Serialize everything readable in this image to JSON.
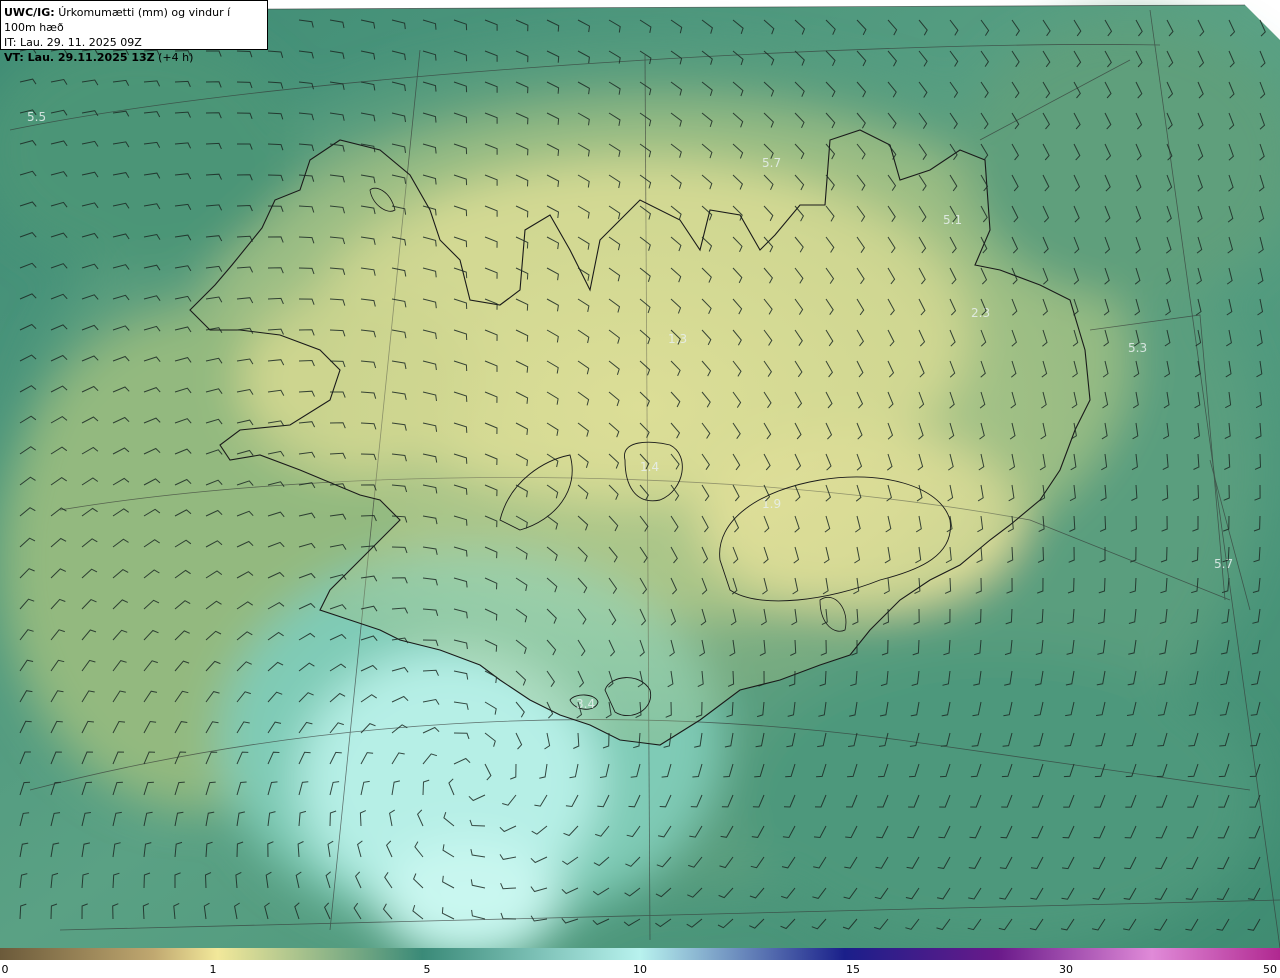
{
  "header": {
    "model": "UWC/IG:",
    "title": "Úrkomumætti (mm) og vindur í 100m hæð",
    "issue_time": "IT: Lau. 29. 11. 2025 09Z",
    "valid_prefix": "VT: Lau. 29.11.2025 13Z",
    "valid_suffix": "(+4 h)"
  },
  "map_labels": [
    "5.5",
    "5.7",
    "5.1",
    "2.3",
    "5.3",
    "5.7",
    "1.4",
    "3.4",
    "1.9",
    "1.3"
  ],
  "colorbar": {
    "ticks": [
      "0",
      "1",
      "5",
      "10",
      "15",
      "30",
      "50"
    ],
    "stops": [
      "#6b5a3a",
      "#c8b478",
      "#f2e89a",
      "#3a8a78",
      "#b8f2ee",
      "#1a2a8a",
      "#6a1a8a",
      "#e08ad8",
      "#f0a8e8"
    ]
  },
  "colors": {
    "sea_dark": "#2f7d6c",
    "sea_mid": "#4f9a80",
    "land_light": "#e6e29a",
    "land_mid": "#9dbf84",
    "cyan_core": "#bff2ea",
    "coast": "#1a1a1a"
  }
}
